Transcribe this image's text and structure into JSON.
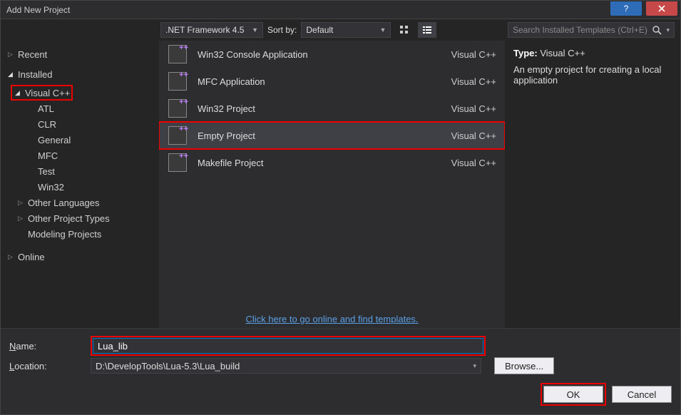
{
  "window": {
    "title": "Add New Project"
  },
  "toolbar": {
    "framework": ".NET Framework 4.5",
    "sort_label": "Sort by:",
    "sort_value": "Default",
    "search_placeholder": "Search Installed Templates (Ctrl+E)"
  },
  "tree": {
    "recent": "Recent",
    "installed": "Installed",
    "visual_cpp": "Visual C++",
    "items": [
      "ATL",
      "CLR",
      "General",
      "MFC",
      "Test",
      "Win32"
    ],
    "other_languages": "Other Languages",
    "other_project_types": "Other Project Types",
    "modeling": "Modeling Projects",
    "online": "Online"
  },
  "templates": [
    {
      "name": "Win32 Console Application",
      "lang": "Visual C++"
    },
    {
      "name": "MFC Application",
      "lang": "Visual C++"
    },
    {
      "name": "Win32 Project",
      "lang": "Visual C++"
    },
    {
      "name": "Empty Project",
      "lang": "Visual C++"
    },
    {
      "name": "Makefile Project",
      "lang": "Visual C++"
    }
  ],
  "online_link": "Click here to go online and find templates.",
  "desc": {
    "type_label": "Type:",
    "type_value": "Visual C++",
    "text": "An empty project for creating a local application"
  },
  "form": {
    "name_label": "Name:",
    "name_value": "Lua_lib",
    "location_label": "Location:",
    "location_value": "D:\\DevelopTools\\Lua-5.3\\Lua_build",
    "browse": "Browse...",
    "ok": "OK",
    "cancel": "Cancel"
  }
}
